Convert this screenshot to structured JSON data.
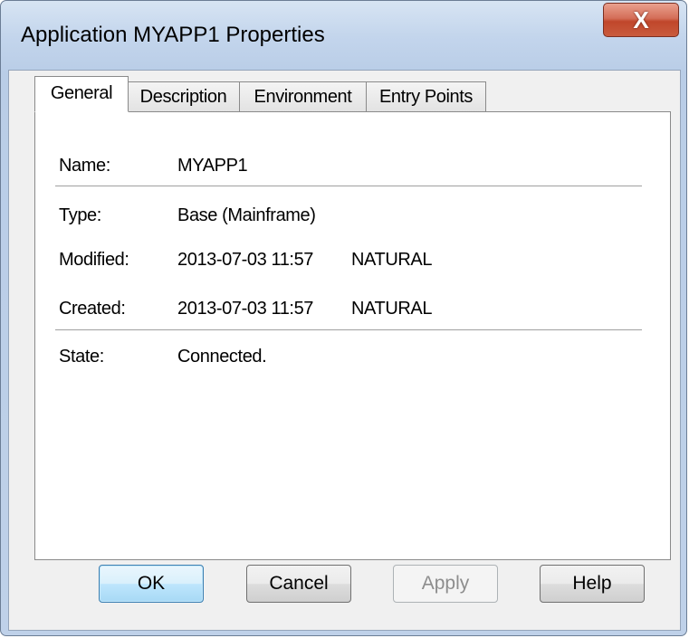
{
  "window": {
    "title": "Application MYAPP1 Properties",
    "close_label": "X",
    "accent": "#c7503a"
  },
  "tabs": [
    {
      "label": "General",
      "active": true
    },
    {
      "label": "Description",
      "active": false
    },
    {
      "label": "Environment",
      "active": false
    },
    {
      "label": "Entry Points",
      "active": false
    }
  ],
  "general": {
    "name": {
      "label": "Name:",
      "value": "MYAPP1"
    },
    "type": {
      "label": "Type:",
      "value": "Base (Mainframe)"
    },
    "modified": {
      "label": "Modified:",
      "date": "2013-07-03 11:57",
      "user": "NATURAL"
    },
    "created": {
      "label": "Created:",
      "date": "2013-07-03 11:57",
      "user": "NATURAL"
    },
    "state": {
      "label": "State:",
      "value": "Connected."
    }
  },
  "buttons": {
    "ok": "OK",
    "cancel": "Cancel",
    "apply": "Apply",
    "help": "Help"
  }
}
